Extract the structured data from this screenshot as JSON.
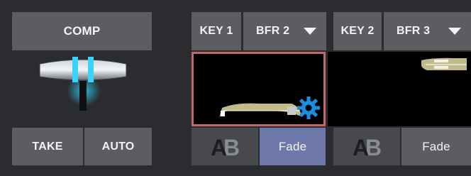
{
  "comp": {
    "label": "COMP"
  },
  "transition": {
    "take_label": "TAKE",
    "auto_label": "AUTO"
  },
  "key1": {
    "label": "KEY 1",
    "source": "BFR 2",
    "transition_label": "Fade"
  },
  "key2": {
    "label": "KEY 2",
    "source": "BFR 3",
    "transition_label": "Fade"
  },
  "icons": {
    "ab": "ab-transition-icon",
    "gear": "gear-icon",
    "chevron": "chevron-down-icon"
  },
  "colors": {
    "preview_border": "#c0676a",
    "fade_selected": "#6f78aa",
    "tbar_glow": "#2cc9f0",
    "gear": "#1a8fe0"
  }
}
